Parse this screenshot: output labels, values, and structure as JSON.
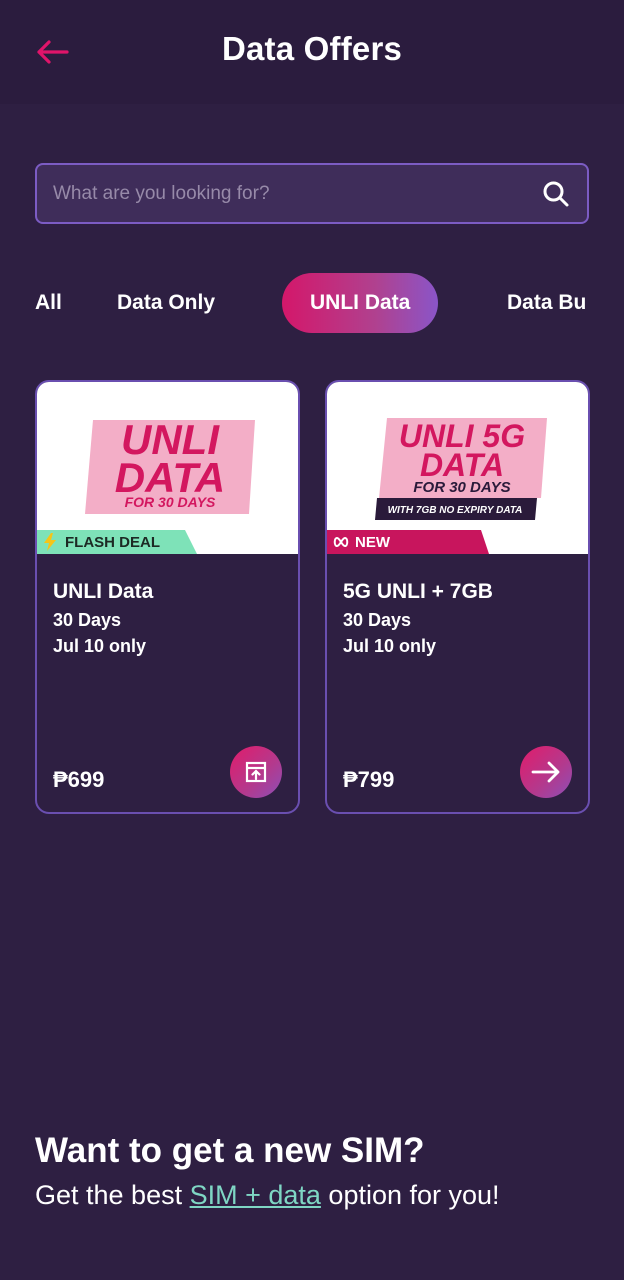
{
  "header": {
    "title": "Data Offers",
    "back_icon": "back-arrow-icon"
  },
  "search": {
    "placeholder": "What are you looking for?",
    "value": "",
    "icon": "search-icon"
  },
  "tabs": [
    {
      "label": "All",
      "active": false
    },
    {
      "label": "Data Only",
      "active": false
    },
    {
      "label": "UNLI Data",
      "active": true
    },
    {
      "label": "Data Bu",
      "active": false
    }
  ],
  "offers": [
    {
      "banner": {
        "line1": "UNLI",
        "line2": "DATA",
        "line3": "FOR 30 DAYS"
      },
      "badge": "FLASH DEAL",
      "badge_icon": "lightning-icon",
      "name": "UNLI Data",
      "validity": "30 Days",
      "availability": "Jul 10 only",
      "price": "₱699",
      "action_icon": "upload-icon"
    },
    {
      "banner": {
        "line1": "UNLI 5G",
        "line2": "DATA",
        "line3": "FOR 30 DAYS",
        "line4": "WITH 7GB NO EXPIRY DATA"
      },
      "badge": "NEW",
      "badge_icon": "infinity-icon",
      "name": "5G UNLI + 7GB",
      "validity": "30 Days",
      "availability": "Jul 10 only",
      "price": "₱799",
      "action_icon": "arrow-right-icon"
    }
  ],
  "promo": {
    "title": "Want to get a new SIM?",
    "text_before": "Get the best ",
    "link": "SIM + data",
    "text_after": " option for you!"
  },
  "colors": {
    "background": "#2e1f42",
    "accent_pink": "#d4176a",
    "accent_purple": "#8a55c8",
    "flash_badge": "#7ee2b8",
    "new_badge": "#c8155d",
    "link": "#7fd6c4"
  }
}
